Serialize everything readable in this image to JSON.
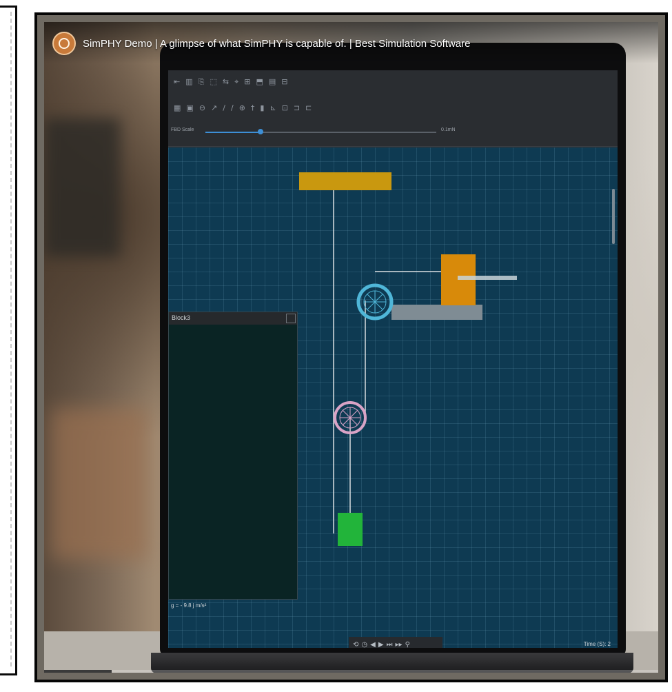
{
  "video": {
    "title": "SimPHY Demo | A glimpse of what SimPHY is capable of. | Best Simulation Software",
    "progress_fraction": 0.11
  },
  "simphy": {
    "toolbar": {
      "row1": [
        "⇤",
        "▥",
        "⎘",
        "⬚",
        "⇆",
        "⌖",
        "⊞",
        "⬒",
        "▤",
        "⊟"
      ],
      "row2": [
        "▦",
        "▣",
        "⊖",
        "↗",
        "/",
        "/",
        "⊕",
        "†",
        "▮",
        "⊾",
        "⊡",
        "⊐",
        "⊏"
      ]
    },
    "fbd_scale": {
      "label": "FBD Scale",
      "value": "0.1mN",
      "fraction": 0.24
    },
    "block_window_title": "Block3",
    "gravity_text": "g = - 9.8 j m/s²",
    "time_text": "Time (S): 2",
    "playbar_icons": [
      "⟲",
      "◷",
      "◀",
      "▶",
      "⏭",
      "▸▸",
      "⚲"
    ]
  },
  "colors": {
    "canvas_bg": "#0e3a52",
    "ceiling": "#c9980f",
    "orange_block": "#d88a0a",
    "green_block": "#22b43a",
    "pulley_top": "#4fb6d8",
    "pulley_bottom": "#d9a3c6",
    "table": "#7f8c94"
  }
}
